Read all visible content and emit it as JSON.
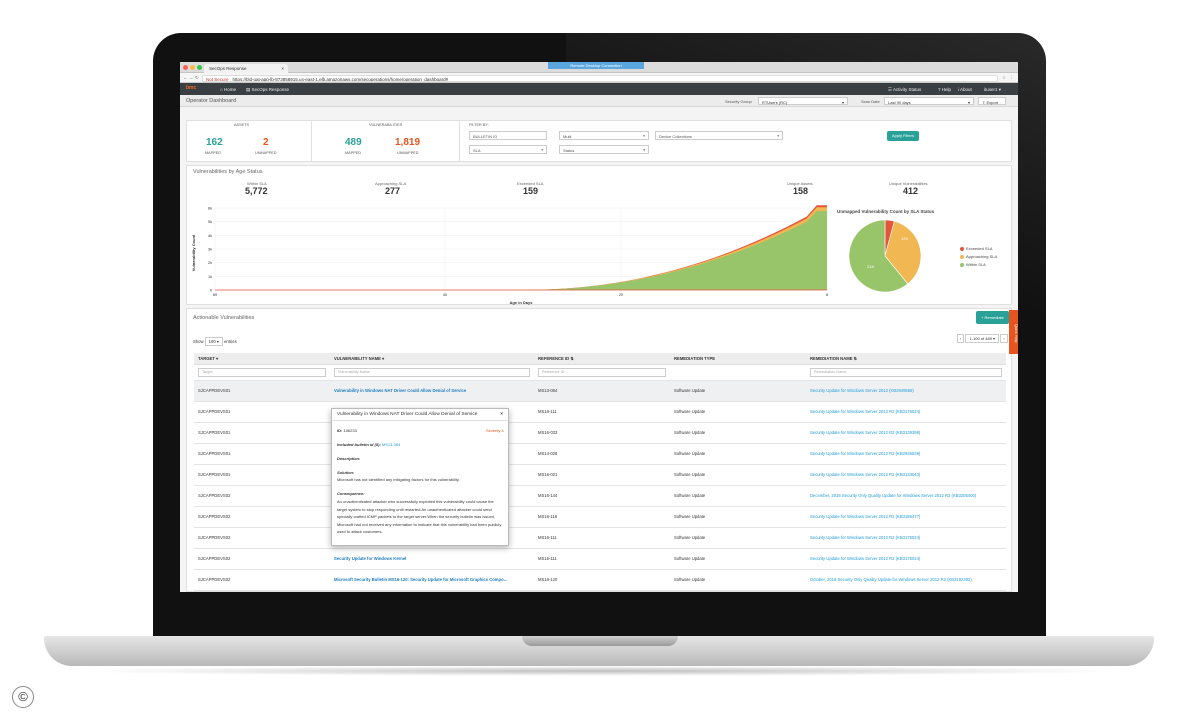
{
  "browser": {
    "tab_title": "SecOps Response",
    "banner": "Remote Desktop Connection",
    "not_secure": "Not Secure",
    "url": "https://bld-uat-app-lb-873858915.us-east-1.elb.amazonaws.com/secoperations/home/operation_dashboard#"
  },
  "app_nav": {
    "logo": "bmc",
    "home": "Home",
    "secops": "SecOps Response",
    "activity": "Activity Status",
    "help": "Help",
    "about": "About",
    "user": "ituser1"
  },
  "header": {
    "title": "Operator Dashboard",
    "security_group_label": "Security Group",
    "security_group_value": "RTUsers (RC)",
    "scan_date_label": "Scan Date",
    "scan_date_value": "Last 90 days",
    "export_label": "Export"
  },
  "assets": {
    "title": "ASSETS",
    "mapped_value": "162",
    "mapped_label": "MAPPED",
    "unmapped_value": "2",
    "unmapped_label": "UNMAPPED"
  },
  "vulnerabilities": {
    "title": "VULNERABILITIES",
    "mapped_value": "489",
    "mapped_label": "MAPPED",
    "unmapped_value": "1,819",
    "unmapped_label": "UNMAPPED"
  },
  "filters": {
    "title": "FILTER BY:",
    "bulletin": "BULLETIN ID",
    "sla": "SLA",
    "multi": "Multi",
    "status": "Status",
    "device": "Device Collections",
    "apply": "Apply Filters"
  },
  "age_status": {
    "title": "Vulnerabilities by Age Status",
    "stats": [
      {
        "label": "Within SLA",
        "value": "5,772"
      },
      {
        "label": "Approaching SLA",
        "value": "277"
      },
      {
        "label": "Exceeded SLA",
        "value": "159"
      },
      {
        "label": "Unique Assets",
        "value": "158"
      },
      {
        "label": "Unique Vulnerabilities",
        "value": "412"
      }
    ]
  },
  "area_chart": {
    "ylabel": "Vulnerability Count",
    "xlabel": "Age in Days",
    "yticks": [
      "6k",
      "5k",
      "4k",
      "3k",
      "2k",
      "1k",
      "0"
    ],
    "xticks": [
      "89",
      "40",
      "20",
      "8"
    ]
  },
  "pie_chart": {
    "title": "Unmapped Vulnerability Count by SLA Status",
    "legend": [
      "Exceeded SLA",
      "Approaching SLA",
      "Within SLA"
    ],
    "labels": [
      "125",
      "218"
    ]
  },
  "chart_data": [
    {
      "type": "area",
      "xlabel": "Age in Days",
      "ylabel": "Vulnerability Count",
      "ylim": [
        0,
        6000
      ],
      "x": [
        "89",
        "40",
        "20",
        "8"
      ],
      "series": [
        {
          "name": "Within SLA",
          "color": "#98c46a",
          "values": [
            0,
            30,
            60,
            5772
          ]
        },
        {
          "name": "Approaching SLA",
          "color": "#f0b752",
          "values": [
            0,
            10,
            20,
            277
          ]
        },
        {
          "name": "Exceeded SLA",
          "color": "#e4563b",
          "values": [
            0,
            5,
            10,
            159
          ]
        }
      ]
    },
    {
      "type": "pie",
      "title": "Unmapped Vulnerability Count by SLA Status",
      "categories": [
        "Exceeded SLA",
        "Approaching SLA",
        "Within SLA"
      ],
      "colors": [
        "#e4563b",
        "#f0b752",
        "#98c46a"
      ],
      "values": [
        15,
        125,
        218
      ]
    }
  ],
  "actionable": {
    "title": "Actionable Vulnerabilities",
    "remediate": "+ Remediate",
    "show_label": "Show",
    "show_value": "100",
    "entries_label": "entries",
    "paging": "1-100 of 489",
    "side_tab": "Quick Help",
    "columns": [
      "TARGET",
      "VULNERABILITY NAME",
      "REFERENCE ID",
      "REMEDIATION TYPE",
      "REMEDIATION NAME"
    ],
    "placeholders": [
      "Target",
      "Vulnerability Name",
      "Reference ID",
      "",
      "Remediation Name"
    ],
    "rows": [
      {
        "target": "SJCAPPDEVS01",
        "vuln": "Vulnerability in Windows NAT Driver Could Allow Denial of Service",
        "ref": "MS13-064",
        "type": "Software Update",
        "rem": "Security Update for Windows Server 2012 (KB2849568)"
      },
      {
        "target": "SJCAPPDEVS01",
        "vuln": "",
        "ref": "MS16-111",
        "type": "Software Update",
        "rem": "Security Update for Windows Server 2012 R2 (KB3175024)"
      },
      {
        "target": "SJCAPPDEVS01",
        "vuln": "",
        "ref": "MS16-033",
        "type": "Software Update",
        "rem": "Security Update for Windows Server 2012 R2 (KB3139398)"
      },
      {
        "target": "SJCAPPDEVS01",
        "vuln": "",
        "ref": "MS14-028",
        "type": "Software Update",
        "rem": "Security Update for Windows Server 2012 R2 (KB2935539)"
      },
      {
        "target": "SJCAPPDEVS01",
        "vuln": "",
        "ref": "MS16-021",
        "type": "Software Update",
        "rem": "Security Update for Windows Server 2012 R2 (KB3133043)"
      },
      {
        "target": "SJCAPPDEVS02",
        "vuln": "",
        "ref": "MS16-144",
        "type": "Software Update",
        "rem": "December, 2016 Security Only Quality Update for Windows Server 2012 R2 (KB3205400)"
      },
      {
        "target": "SJCAPPDEVS02",
        "vuln": "",
        "ref": "MS16-118",
        "type": "Software Update",
        "rem": "Security Update for Windows Server 2012 R2 (KB3185477)"
      },
      {
        "target": "SJCAPPDEVS02",
        "vuln": "",
        "ref": "MS16-111",
        "type": "Software Update",
        "rem": "Security Update for Windows Server 2012 R2 (KB3175024)"
      },
      {
        "target": "SJCAPPDEVS02",
        "vuln": "Security Update for Windows Kernel",
        "ref": "MS16-111",
        "type": "Software Update",
        "rem": "Security Update for Windows Server 2012 R2 (KB3175024)"
      },
      {
        "target": "SJCAPPDEVS02",
        "vuln": "Microsoft Security Bulletin MS16-120: Security Update for Microsoft Graphics Compo...",
        "ref": "MS16-120",
        "type": "Software Update",
        "rem": "October, 2016 Security Only Quality Update for Windows Server 2012 R2 (KB3192392)"
      }
    ]
  },
  "popup": {
    "title": "Vulnerability in Windows NAT Driver Could Allow Denial of Service",
    "id_label": "ID:",
    "id_value": "106233",
    "severity": "Severity 4",
    "bulletin_label": "Included bulletin id (5):",
    "bulletin_value": "MS13-064",
    "description_label": "Description:",
    "solution_label": "Solution:",
    "solution_text": "Microsoft has not identified any mitigating factors for this vulnerability.",
    "consequence_label": "Consequence:",
    "consequence_text": "An unauthenticated attacker who successfully exploited this vulnerability could cause the target system to stop responding until restarted.An unauthenticated attacker could send specially crafted ICMP packets to the target server.When the security bulletin was issued, Microsoft had not received any information to indicate that this vulnerability had been publicly used to attack customers."
  }
}
